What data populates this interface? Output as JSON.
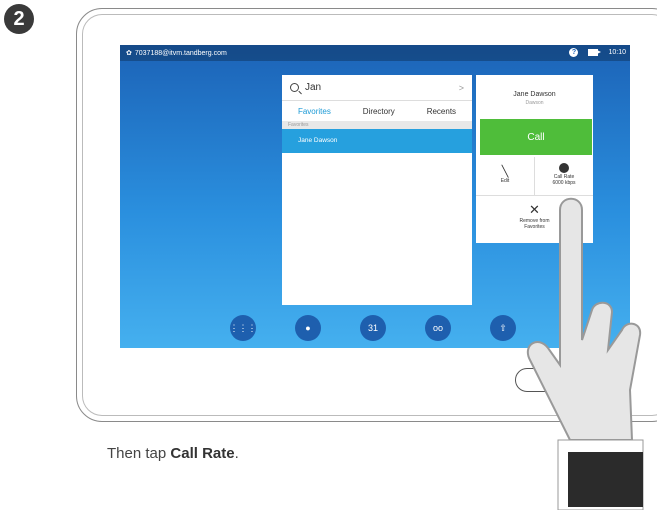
{
  "step": {
    "number": "2"
  },
  "topbar": {
    "sip_uri": "7037188@itvm.tandberg.com",
    "time": "10:10"
  },
  "search": {
    "value": "Jan"
  },
  "tabs": [
    {
      "label": "Favorites",
      "active": true
    },
    {
      "label": "Directory",
      "active": false
    },
    {
      "label": "Recents",
      "active": false
    }
  ],
  "list": {
    "section_label": "Favorites",
    "items": [
      {
        "label": "Jane Dawson",
        "selected": true
      }
    ]
  },
  "contact_card": {
    "name": "Jane Dawson",
    "subtitle": "Dawson",
    "call_label": "Call",
    "edit_label": "Edit",
    "call_rate_label": "Call Rate",
    "call_rate_value": "6000 kbps",
    "remove_label": "Remove from Favorites"
  },
  "dock": [
    {
      "icon": "keypad-icon"
    },
    {
      "icon": "contacts-icon"
    },
    {
      "icon": "calendar-icon",
      "text": "31"
    },
    {
      "icon": "voicemail-icon"
    },
    {
      "icon": "share-icon"
    }
  ],
  "caption": {
    "prefix": "Then tap ",
    "bold": "Call Rate",
    "suffix": "."
  },
  "colors": {
    "screen_top": "#1c63b7",
    "screen_bottom": "#45b0ef",
    "call_green": "#4fbd3a",
    "selected_blue": "#26a0de"
  }
}
